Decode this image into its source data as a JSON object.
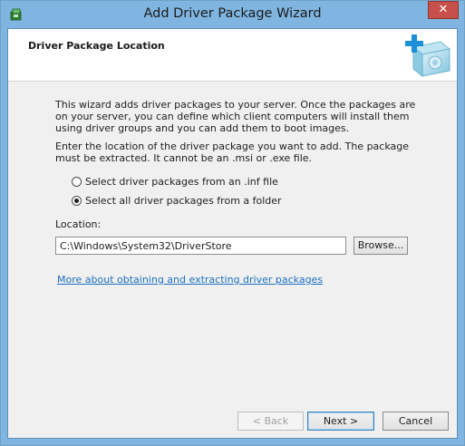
{
  "window": {
    "title": "Add Driver Package Wizard",
    "close_label": "✕"
  },
  "header": {
    "title": "Driver Package Location"
  },
  "content": {
    "intro": "This wizard adds driver packages to your server. Once the packages are on your server, you can define which client computers will install them using driver groups and you can add them to boot images.",
    "instruction": "Enter the location of the driver package you want to add. The package must be extracted. It cannot be an .msi or .exe file.",
    "options": [
      {
        "label": "Select driver packages from an .inf file",
        "checked": false
      },
      {
        "label": "Select all driver packages from a folder",
        "checked": true
      }
    ],
    "location_label": "Location:",
    "location_value": "C:\\Windows\\System32\\DriverStore",
    "browse_label": "Browse...",
    "more_link": "More about obtaining and extracting driver packages"
  },
  "footer": {
    "back_label": "< Back",
    "next_label": "Next >",
    "cancel_label": "Cancel"
  },
  "icons": {
    "app": "driver-wizard-icon",
    "header": "driver-package-plus-icon"
  },
  "colors": {
    "titlebar": "#7fb5e0",
    "close": "#c7504b",
    "link": "#1b6fc2"
  }
}
